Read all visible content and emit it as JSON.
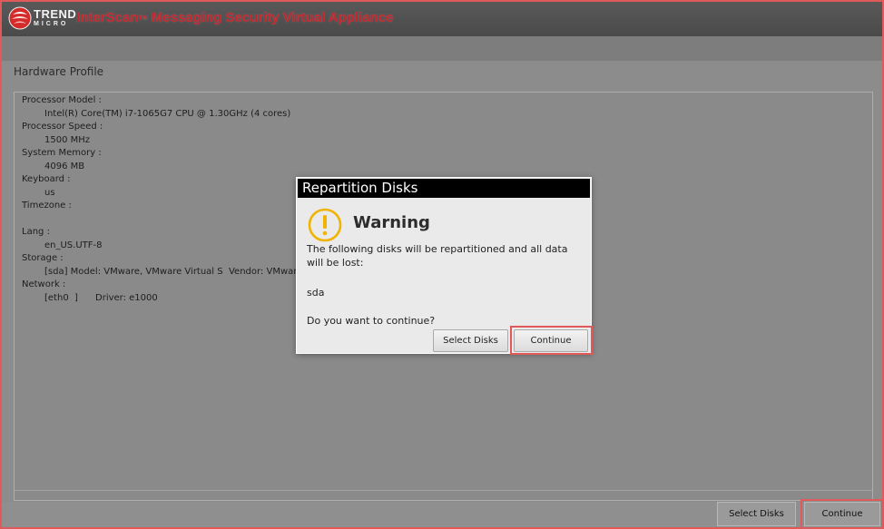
{
  "header": {
    "brand_top": "TREND",
    "brand_bottom": "MICRO",
    "product_name": "InterScan",
    "product_tm": "TM",
    "product_rest": " Messaging Security Virtual Appliance",
    "brand_color": "#c4262e"
  },
  "section_title": "Hardware Profile",
  "profile": {
    "processor_model_label": "Processor Model :",
    "processor_model_value": "Intel(R) Core(TM) i7-1065G7 CPU @ 1.30GHz (4 cores)",
    "processor_speed_label": "Processor Speed :",
    "processor_speed_value": "1500 MHz",
    "memory_label": "System Memory :",
    "memory_value": "4096 MB",
    "keyboard_label": "Keyboard :",
    "keyboard_value": "us",
    "timezone_label": "Timezone :",
    "lang_label": "Lang :",
    "lang_value": "en_US.UTF-8",
    "storage_label": "Storage :",
    "storage_value": "[sda] Model: VMware, VMware Virtual S  Vendor: VMware_  Siz",
    "network_label": "Network :",
    "network_value": "[eth0  ]      Driver: e1000"
  },
  "footer": {
    "select_disks": "Select Disks",
    "continue": "Continue"
  },
  "dialog": {
    "title": "Repartition Disks",
    "warning_title": "Warning",
    "message": "The following disks will be repartitioned and all data will be lost:",
    "disk": "sda",
    "question": "Do you want to continue?",
    "select_disks": "Select Disks",
    "continue": "Continue",
    "icon": "warning-icon",
    "warning_color": "#f0b400",
    "highlight_color": "#e05a5a"
  }
}
